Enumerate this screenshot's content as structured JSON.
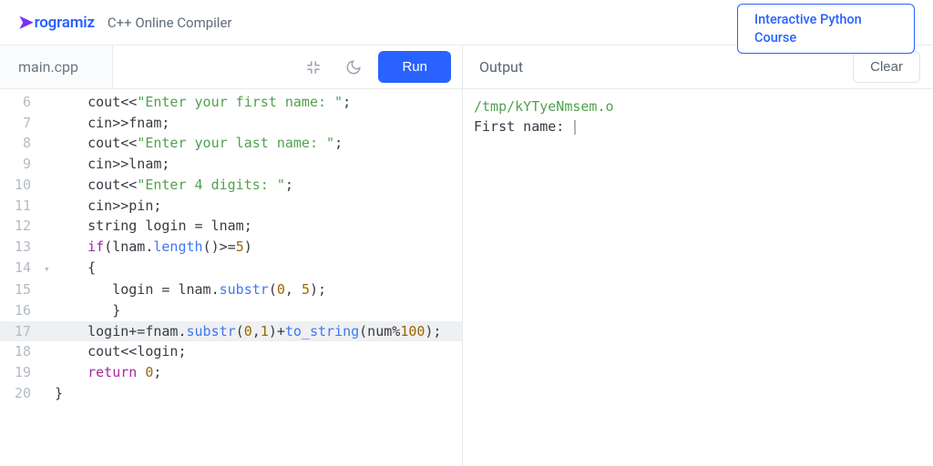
{
  "header": {
    "brand": "rogramiz",
    "subtitle": "C++ Online Compiler",
    "cta": "Interactive Python Course"
  },
  "toolbar": {
    "tab": "main.cpp",
    "run": "Run",
    "output_title": "Output",
    "clear": "Clear"
  },
  "gutter": [
    "6",
    "7",
    "8",
    "9",
    "10",
    "11",
    "12",
    "13",
    "14",
    "15",
    "16",
    "17",
    "18",
    "19",
    "20"
  ],
  "code": {
    "l6": {
      "a": "    cout",
      "b": "<<",
      "c": "\"Enter your first name: \"",
      "d": ";"
    },
    "l7": {
      "a": "    cin",
      "b": ">>",
      "c": "fnam;"
    },
    "l8": {
      "a": "    cout",
      "b": "<<",
      "c": "\"Enter your last name: \"",
      "d": ";"
    },
    "l9": {
      "a": "    cin",
      "b": ">>",
      "c": "lnam;"
    },
    "l10": {
      "a": "    cout",
      "b": "<<",
      "c": "\"Enter 4 digits: \"",
      "d": ";"
    },
    "l11": {
      "a": "    cin",
      "b": ">>",
      "c": "pin;"
    },
    "l12": {
      "a": "    string login ",
      "b": "=",
      "c": " lnam;"
    },
    "l13": {
      "a": "    ",
      "b": "if",
      "c": "(lnam.",
      "d": "length",
      "e": "()",
      "f": ">=",
      "g": "5",
      "h": ")"
    },
    "l14": {
      "a": "    {"
    },
    "l15": {
      "a": "       login ",
      "b": "=",
      "c": " lnam.",
      "d": "substr",
      "e": "(",
      "f": "0",
      "g": ", ",
      "h": "5",
      "i": ");"
    },
    "l16": {
      "a": "       }"
    },
    "l17": {
      "a": "    login",
      "b": "+=",
      "c": "fnam.",
      "d": "substr",
      "e": "(",
      "f": "0",
      "g": ",",
      "h": "1",
      "i": ")",
      "j": "+",
      "k": "to_string",
      "l": "(num",
      "m": "%",
      "n": "100",
      "o": ");"
    },
    "l18": {
      "a": "    cout",
      "b": "<<",
      "c": "login;"
    },
    "l19": {
      "a": "    ",
      "b": "return",
      "c": " ",
      "d": "0",
      "e": ";"
    },
    "l20": {
      "a": "}"
    }
  },
  "output": {
    "l1": "/tmp/kYTyeNmsem.o",
    "l2": "First name: "
  }
}
